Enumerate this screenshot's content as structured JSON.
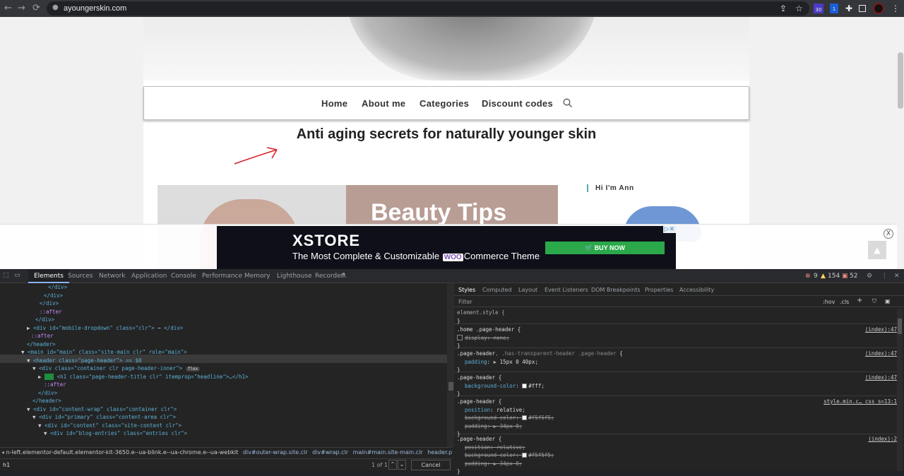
{
  "browser": {
    "back": "←",
    "forward": "→",
    "reload": "⟳",
    "lock": "🔒",
    "url": "ayoungerskin.com",
    "ext_badge_1": "30",
    "ext_badge_2": "1"
  },
  "site": {
    "nav": [
      "Home",
      "About me",
      "Categories",
      "Discount codes"
    ],
    "title": "Anti aging secrets for naturally younger skin",
    "featured_image_text": "Beauty Tips",
    "sidebar_title": "Hi I'm Ann",
    "to_top": "▲"
  },
  "ad": {
    "logo": "XSTORE",
    "tagline_before": "The Most Complete & Customizable",
    "woo": "WOO",
    "tagline_after": "Commerce Theme",
    "button": "BUY NOW",
    "close": "X"
  },
  "devtools": {
    "tabs": [
      "Elements",
      "Sources",
      "Network",
      "Application",
      "Console",
      "Performance",
      "Memory",
      "Lighthouse",
      "Recorder"
    ],
    "errors": "9",
    "warnings": "154",
    "issues": "52",
    "style_tabs": [
      "Styles",
      "Computed",
      "Layout",
      "Event Listeners",
      "DOM Breakpoints",
      "Properties",
      "Accessibility"
    ],
    "filter_placeholder": "Filter",
    "hov": ":hov",
    "cls": ".cls",
    "dom_lines": [
      "</div>",
      "</div>",
      "</div>",
      "::after",
      "</div>",
      "<div id=\"mobile-dropdown\" class=\"clr\">",
      "::after",
      "</header>",
      "<main id=\"main\" class=\"site-main clr\" role=\"main\">",
      "<header class=\"page-header\"> == $0",
      "<div class=\"container clr page-header-inner\">",
      "<h1 class=\"page-header-title clr\" itemprop=\"headline\">…</h1>",
      "::after",
      "</div>",
      "</header>",
      "<div id=\"content-wrap\" class=\"container clr\">",
      "<div id=\"primary\" class=\"content-area clr\">",
      "<div id=\"content\" class=\"site-content clr\">",
      "<div id=\"blog-entries\" class=\"entries clr\">"
    ],
    "flex_badge": "flex",
    "h1_badge": "h1",
    "rules": [
      {
        "selector": "element.style {",
        "source": "",
        "props": []
      },
      {
        "selector": ".home .page-header {",
        "source": "(index):47",
        "props": [
          {
            "name": "display",
            "value": "none;",
            "struck": true,
            "checkbox": true
          }
        ]
      },
      {
        "selector": ".page-header, .has-transparent-header .page-header {",
        "source": "(index):47",
        "props": [
          {
            "name": "padding",
            "value": "15px 0 40px;",
            "struck": false
          }
        ]
      },
      {
        "selector": ".page-header {",
        "source": "(index):47",
        "props": [
          {
            "name": "background-color",
            "value": "#fff;",
            "struck": false,
            "swatch": "#ffffff"
          }
        ]
      },
      {
        "selector": ".page-header {",
        "source": "style.min.c…_css_s=13:1",
        "props": [
          {
            "name": "position",
            "value": "relative;",
            "struck": false
          },
          {
            "name": "background-color",
            "value": "#f5f5f5;",
            "struck": true,
            "swatch": "#f5f5f5"
          },
          {
            "name": "padding",
            "value": "34px 0;",
            "struck": true
          }
        ]
      },
      {
        "selector": ".page-header {",
        "source": "(index):2",
        "props": [
          {
            "name": "position",
            "value": "relative;",
            "struck": true
          },
          {
            "name": "background-color",
            "value": "#f5f5f5;",
            "struck": true,
            "swatch": "#f5f5f5"
          },
          {
            "name": "padding",
            "value": "34px 0;",
            "struck": true
          }
        ]
      }
    ],
    "breadcrumb": [
      "n-left.elementor-default.elementor-kit-3650.e--ua-blink.e--ua-chrome.e--ua-webkit",
      "div#outer-wrap.site.clr",
      "div#wrap.clr",
      "main#main.site-main.clr",
      "header.page-header"
    ],
    "search_value": "h1",
    "search_count": "1 of 1",
    "cancel": "Cancel"
  },
  "colors": {
    "annotation_red": "#d8222a",
    "ad_button": "#2aa84a"
  }
}
